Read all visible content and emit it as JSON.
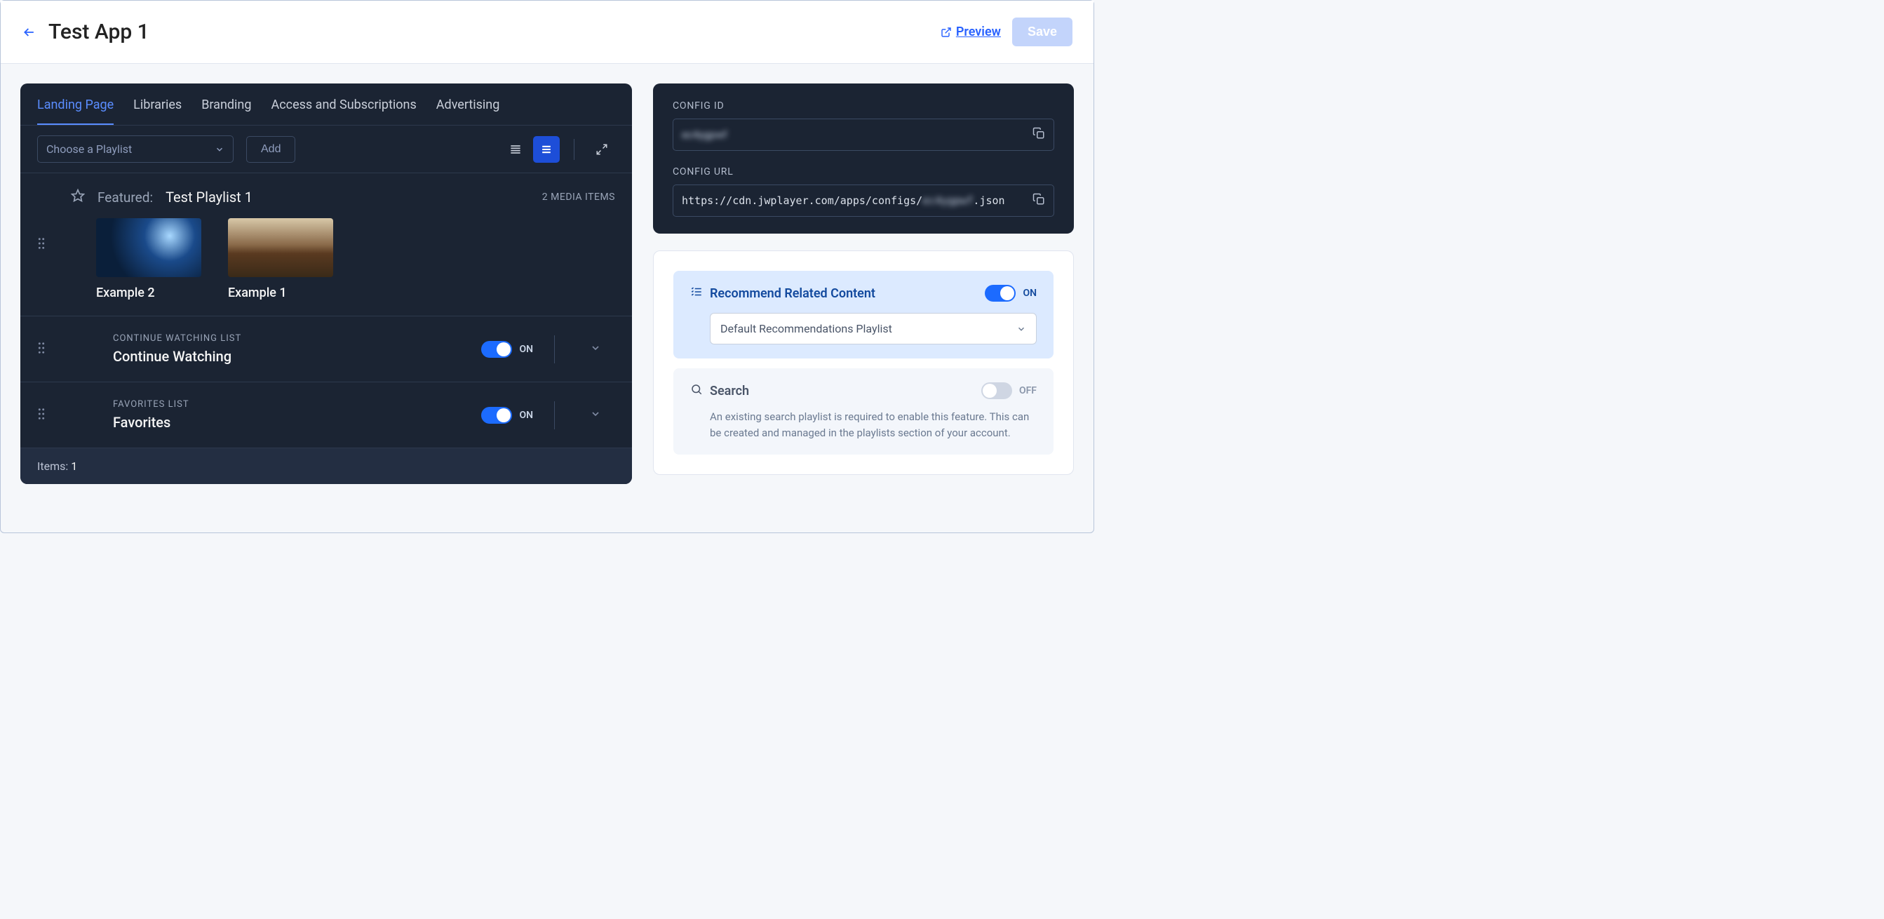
{
  "header": {
    "title": "Test App 1",
    "preview_label": "Preview",
    "save_label": "Save"
  },
  "tabs": [
    "Landing Page",
    "Libraries",
    "Branding",
    "Access and Subscriptions",
    "Advertising"
  ],
  "active_tab": 0,
  "toolbar": {
    "playlist_placeholder": "Choose a Playlist",
    "add_label": "Add"
  },
  "featured": {
    "label": "Featured:",
    "title": "Test Playlist 1",
    "count_label": "2 MEDIA ITEMS",
    "items": [
      {
        "label": "Example 2"
      },
      {
        "label": "Example 1"
      }
    ]
  },
  "rows": [
    {
      "label": "CONTINUE WATCHING LIST",
      "title": "Continue Watching",
      "toggle": "ON"
    },
    {
      "label": "FAVORITES LIST",
      "title": "Favorites",
      "toggle": "ON"
    }
  ],
  "footer": {
    "items_prefix": "Items:",
    "items_count": "1"
  },
  "config": {
    "id_label": "CONFIG ID",
    "id_value": "ec4ygpwf",
    "url_label": "CONFIG URL",
    "url_value_prefix": "https://cdn.jwplayer.com/apps/configs/",
    "url_value_mask": "ec4ygpwf",
    "url_value_suffix": ".json"
  },
  "settings": {
    "recommend": {
      "title": "Recommend Related Content",
      "toggle": "ON",
      "select_value": "Default Recommendations Playlist"
    },
    "search": {
      "title": "Search",
      "toggle": "OFF",
      "hint": "An existing search playlist is required to enable this feature. This can be created and managed in the playlists section of your account."
    }
  }
}
